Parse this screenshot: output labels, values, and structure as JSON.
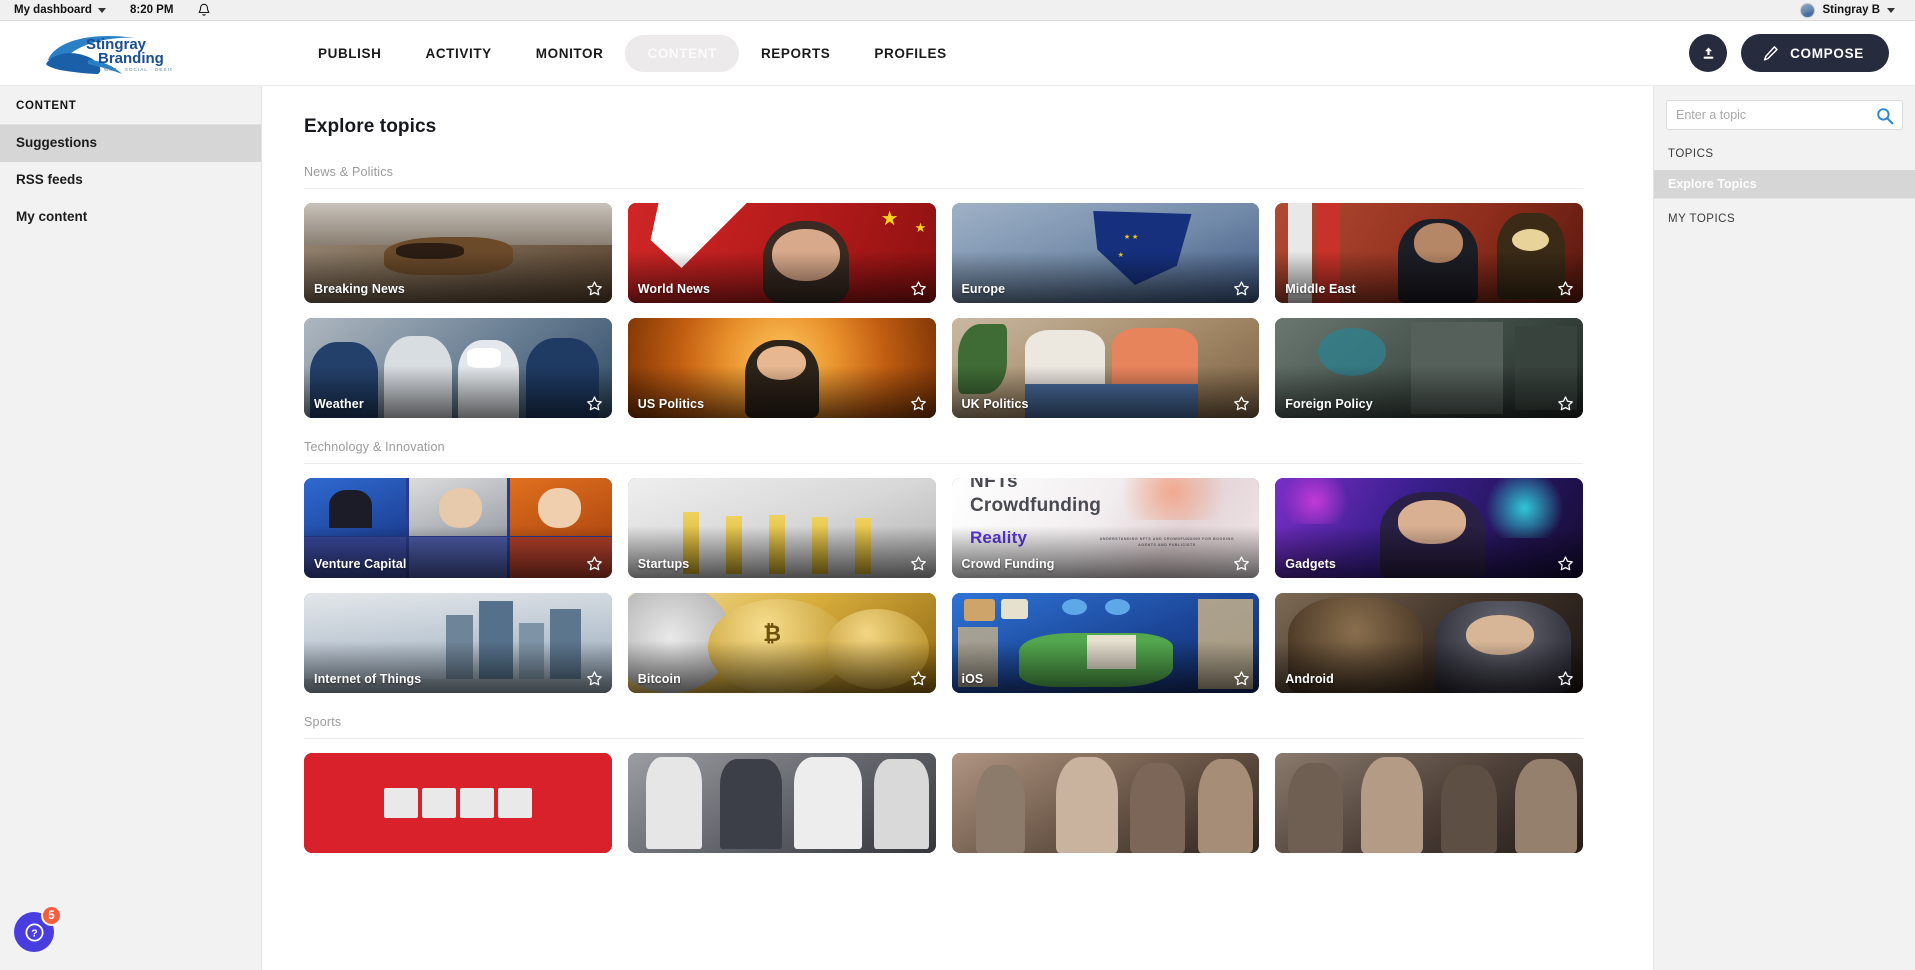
{
  "statusbar": {
    "dashboard_label": "My dashboard",
    "time": "8:20 PM",
    "bell_icon": "bell-icon",
    "user_name": "Stingray B"
  },
  "header": {
    "logo_line1": "Stingray",
    "logo_line2": "Branding",
    "logo_tagline": "WEB · SOCIAL · DESIGN",
    "nav": [
      {
        "label": "PUBLISH",
        "active": false
      },
      {
        "label": "ACTIVITY",
        "active": false
      },
      {
        "label": "MONITOR",
        "active": false
      },
      {
        "label": "CONTENT",
        "active": true
      },
      {
        "label": "REPORTS",
        "active": false
      },
      {
        "label": "PROFILES",
        "active": false
      }
    ],
    "upload_button": "upload-icon",
    "compose_label": "COMPOSE"
  },
  "sidebar": {
    "heading": "CONTENT",
    "items": [
      {
        "label": "Suggestions",
        "active": true
      },
      {
        "label": "RSS feeds",
        "active": false
      },
      {
        "label": "My content",
        "active": false
      }
    ]
  },
  "main": {
    "title": "Explore topics",
    "sections": [
      {
        "label": "News & Politics",
        "cards": [
          {
            "label": "Breaking News",
            "art": "dog-on-patio",
            "c1": "#8a7d70",
            "c2": "#6d5a49",
            "c3": "#4a3b2e"
          },
          {
            "label": "World News",
            "art": "leader-red-flags",
            "c1": "#d93636",
            "c2": "#b32020",
            "c3": "#7e1414"
          },
          {
            "label": "Europe",
            "art": "eu-flag-sky",
            "c1": "#8fa4bd",
            "c2": "#4a68a8",
            "c3": "#22336b"
          },
          {
            "label": "Middle East",
            "art": "official-clock",
            "c1": "#b8452f",
            "c2": "#8c2e1e",
            "c3": "#52170f"
          },
          {
            "label": "Weather",
            "art": "medical-staff",
            "c1": "#7d8a99",
            "c2": "#49637f",
            "c3": "#24384f"
          },
          {
            "label": "US Politics",
            "art": "speaker-podium",
            "c1": "#f0a23c",
            "c2": "#d4701a",
            "c3": "#8a3c08"
          },
          {
            "label": "UK Politics",
            "art": "two-people-bench",
            "c1": "#c9b49b",
            "c2": "#a8apr",
            "c3": "#6d5440"
          },
          {
            "label": "Foreign Policy",
            "art": "street-mural",
            "c1": "#5c6a63",
            "c2": "#37443f",
            "c3": "#1b2220"
          }
        ]
      },
      {
        "label": "Technology & Innovation",
        "cards": [
          {
            "label": "Venture Capital",
            "art": "tv-panel-grid",
            "c1": "#3b5bc0",
            "c2": "#c0452a",
            "c3": "#23306b"
          },
          {
            "label": "Startups",
            "art": "bar-chart-gold",
            "c1": "#d9d9d9",
            "c2": "#c2c2c2",
            "c3": "#9e9e9e"
          },
          {
            "label": "Crowd Funding",
            "art": "nft-crowdfunding-slide",
            "c1": "#ffffff",
            "c2": "#e9e4e6",
            "c3": "#d3cdd2",
            "overlay_text": {
              "line1": "NFTs",
              "line2": "Crowdfunding",
              "line3": "Reality",
              "line4": "UNDERSTANDING NFTS AND CROWDFUNDING FOR BOOKING AGENTS AND PUBLICISTS"
            }
          },
          {
            "label": "Gadgets",
            "art": "man-neon-purple",
            "c1": "#7b2ec8",
            "c2": "#2b1b6e",
            "c3": "#100a2a"
          },
          {
            "label": "Internet of Things",
            "art": "city-skyline-fog",
            "c1": "#cfd6dc",
            "c2": "#8d9eb0",
            "c3": "#4f6274"
          },
          {
            "label": "Bitcoin",
            "art": "gold-coins",
            "c1": "#f0cf6d",
            "c2": "#c99a27",
            "c3": "#7d5c11"
          },
          {
            "label": "iOS",
            "art": "blue-game-map",
            "c1": "#2f6fd0",
            "c2": "#1b3f8c",
            "c3": "#0e2050"
          },
          {
            "label": "Android",
            "art": "characters-dark",
            "c1": "#6b5a4a",
            "c2": "#3a2e26",
            "c3": "#171210"
          }
        ]
      },
      {
        "label": "Sports",
        "cards": [
          {
            "label": "",
            "art": "espn-logo-red",
            "c1": "#d8212a",
            "c2": "#b8151e",
            "c3": "#8d0d14"
          },
          {
            "label": "",
            "art": "football-players",
            "c1": "#8d8f94",
            "c2": "#5a5d63",
            "c3": "#2e3035"
          },
          {
            "label": "",
            "art": "crowd-cheering",
            "c1": "#9c7f6e",
            "c2": "#5f4a3e",
            "c3": "#2c221c"
          },
          {
            "label": "",
            "art": "basketball-crowd",
            "c1": "#7a6b62",
            "c2": "#4a3f38",
            "c3": "#221c18"
          }
        ]
      }
    ]
  },
  "rightpanel": {
    "search_placeholder": "Enter a topic",
    "search_value": "",
    "search_icon": "search-icon",
    "topics_heading": "TOPICS",
    "explore_label": "Explore Topics",
    "my_topics_heading": "MY TOPICS"
  },
  "help": {
    "icon": "question-mark-icon",
    "badge_count": "5"
  },
  "colors": {
    "accent_dark": "#262b3d",
    "active_pill": "#eceaea",
    "help_blue": "#4a3de0",
    "badge_orange": "#f4603f",
    "search_blue": "#2f87c9"
  }
}
